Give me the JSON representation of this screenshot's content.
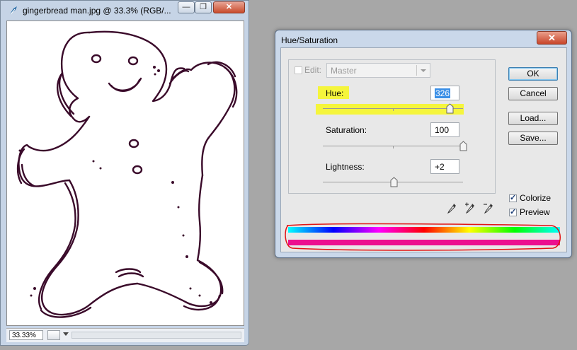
{
  "document": {
    "title": "gingerbread man.jpg @ 33.3% (RGB/...",
    "minimize_glyph": "—",
    "restore_glyph": "❐",
    "close_glyph": "✕",
    "zoom": "33.33%"
  },
  "dialog": {
    "title": "Hue/Saturation",
    "close_glyph": "✕",
    "edit_label": "Edit:",
    "edit_value": "Master",
    "hue": {
      "label": "Hue:",
      "value": "326",
      "level": 326,
      "min": -180,
      "max": 180
    },
    "saturation": {
      "label": "Saturation:",
      "value": "100",
      "level": 100,
      "min": 0,
      "max": 100
    },
    "lightness": {
      "label": "Lightness:",
      "value": "+2",
      "level": 2,
      "min": -100,
      "max": 100
    },
    "buttons": {
      "ok": "OK",
      "cancel": "Cancel",
      "load": "Load...",
      "save": "Save..."
    },
    "colorize": {
      "label": "Colorize",
      "checked": true
    },
    "preview": {
      "label": "Preview",
      "checked": true
    },
    "result_color": "#ec0f8f",
    "highlight_color": "#f5f53c",
    "annotation_color": "#e11414"
  }
}
